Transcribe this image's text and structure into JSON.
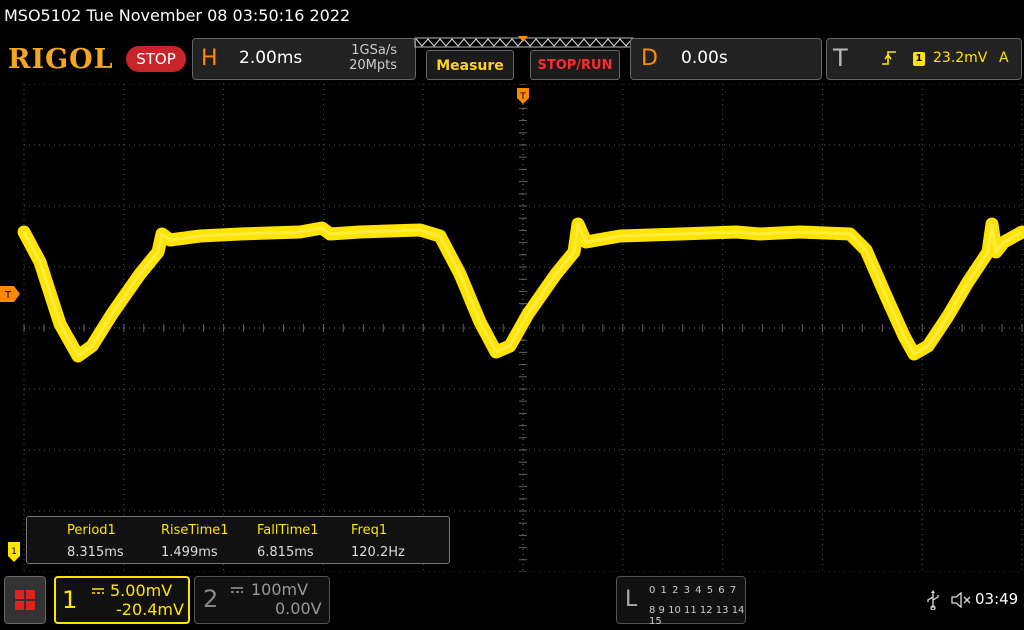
{
  "header": {
    "title": "MSO5102  Tue November 08 03:50:16 2022"
  },
  "toolbar": {
    "logo": "RIGOL",
    "status": "STOP",
    "horizontal": {
      "key": "H",
      "timebase": "2.00ms",
      "sample_rate": "1GSa/s",
      "memory_depth": "20Mpts"
    },
    "measure_label": "Measure",
    "stop_run_label": "STOP/RUN",
    "delay": {
      "key": "D",
      "value": "0.00s"
    },
    "trigger": {
      "key": "T",
      "source": "1",
      "level": "23.2mV",
      "mode": "A"
    }
  },
  "screen": {
    "trigger_marker": "T",
    "channel_marker": "1",
    "colors": {
      "trace": "#ffe400",
      "grid": "#8a8a8a",
      "accent": "#ff8a00",
      "stop": "#c7252a"
    }
  },
  "measurements": {
    "items": [
      {
        "name": "Period1",
        "value": "8.315ms"
      },
      {
        "name": "RiseTime1",
        "value": "1.499ms"
      },
      {
        "name": "FallTime1",
        "value": "6.815ms"
      },
      {
        "name": "Freq1",
        "value": "120.2Hz"
      }
    ]
  },
  "channels": {
    "ch1": {
      "num": "1",
      "scale": "5.00mV",
      "offset": "-20.4mV"
    },
    "ch2": {
      "num": "2",
      "scale": "100mV",
      "offset": "0.00V"
    }
  },
  "logic": {
    "letter": "L",
    "row1": "0 1 2 3   4 5 6 7",
    "row2": "8  9 10 11  12 13 14 15"
  },
  "status_bar": {
    "time": "03:49",
    "icons": [
      "usb-icon",
      "mute-icon"
    ]
  }
}
